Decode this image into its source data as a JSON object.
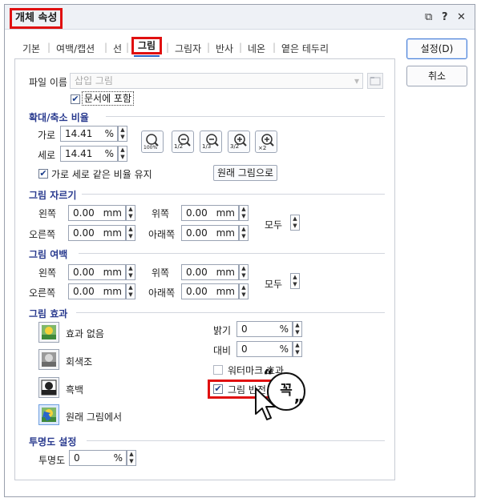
{
  "window": {
    "title": "개체 속성",
    "controls": [
      "⧉",
      "?",
      "✕"
    ]
  },
  "tabs": [
    "기본",
    "여백/캡션",
    "선",
    "그림",
    "그림자",
    "반사",
    "네온",
    "옅은 테두리"
  ],
  "side_buttons": {
    "ok": "설정(D)",
    "cancel": "취소"
  },
  "file": {
    "label": "파일 이름",
    "value": "삽입 그림",
    "embed_label": "문서에 포함"
  },
  "scale": {
    "title": "확대/축소 비율",
    "width_label": "가로",
    "width_value": "14.41",
    "width_unit": "%",
    "height_label": "세로",
    "height_value": "14.41",
    "height_unit": "%",
    "keep_ratio_label": "가로 세로 같은 비율 유지",
    "original_button": "원래 그림으로",
    "zoom_100": "100%",
    "zoom_half": "1/2",
    "zoom_third": "1/3",
    "zoom_3half": "3/2",
    "zoom_x2": "×2"
  },
  "crop": {
    "title": "그림 자르기",
    "left_label": "왼쪽",
    "left_value": "0.00",
    "right_label": "오른쪽",
    "right_value": "0.00",
    "top_label": "위쪽",
    "top_value": "0.00",
    "bottom_label": "아래쪽",
    "bottom_value": "0.00",
    "unit": "mm",
    "all_label": "모두"
  },
  "margin": {
    "title": "그림 여백",
    "left_label": "왼쪽",
    "left_value": "0.00",
    "right_label": "오른쪽",
    "right_value": "0.00",
    "top_label": "위쪽",
    "top_value": "0.00",
    "bottom_label": "아래쪽",
    "bottom_value": "0.00",
    "unit": "mm",
    "all_label": "모두"
  },
  "effect": {
    "title": "그림 효과",
    "none_label": "효과 없음",
    "gray_label": "회색조",
    "bw_label": "흑백",
    "original_label": "원래 그림에서",
    "brightness_label": "밝기",
    "brightness_value": "0",
    "contrast_label": "대비",
    "contrast_value": "0",
    "unit": "%",
    "watermark_label": "워터마크 효과",
    "invert_label": "그림 반전"
  },
  "transparency": {
    "title": "투명도 설정",
    "label": "투명도",
    "value": "0",
    "unit": "%"
  },
  "annotation": {
    "badge": "꼭"
  },
  "colors": {
    "accent": "#2a66c8",
    "highlight": "#e01010",
    "section": "#2a3b8f"
  }
}
